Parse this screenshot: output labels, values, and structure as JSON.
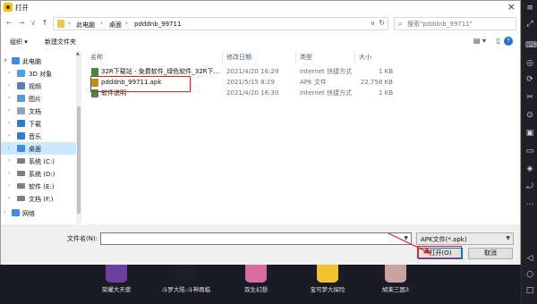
{
  "dialog": {
    "title": "打开",
    "close_glyph": "×"
  },
  "address": {
    "crumbs": [
      "此电脑",
      "桌面",
      "pdddnb_99711"
    ],
    "separator": "›",
    "dropdown_glyph": "∨",
    "refresh_glyph": "↻"
  },
  "search": {
    "placeholder": "搜索\"pdddnb_99711\""
  },
  "toolbar": {
    "organize_label": "组织 ▾",
    "new_folder_label": "新建文件夹"
  },
  "nav": {
    "items": [
      {
        "label": "此电脑",
        "icon": "computer-icon",
        "color": "#3b8ee8"
      },
      {
        "label": "3D 对象",
        "icon": "cube-icon",
        "color": "#4aa3df"
      },
      {
        "label": "视频",
        "icon": "video-icon",
        "color": "#5b7db1"
      },
      {
        "label": "图片",
        "icon": "picture-icon",
        "color": "#5b9bd5"
      },
      {
        "label": "文档",
        "icon": "document-icon",
        "color": "#8da4c0"
      },
      {
        "label": "下载",
        "icon": "download-icon",
        "color": "#2f7ccf"
      },
      {
        "label": "音乐",
        "icon": "music-icon",
        "color": "#2f7ccf"
      },
      {
        "label": "桌面",
        "icon": "desktop-icon",
        "color": "#3b8ee8"
      },
      {
        "label": "系统 (C:)",
        "icon": "drive-icon",
        "color": "#7f7f7f"
      },
      {
        "label": "系统 (D:)",
        "icon": "drive-icon",
        "color": "#7f7f7f"
      },
      {
        "label": "软件 (E:)",
        "icon": "drive-icon",
        "color": "#7f7f7f"
      },
      {
        "label": "文档 (F:)",
        "icon": "drive-icon",
        "color": "#7f7f7f"
      },
      {
        "label": "网络",
        "icon": "network-icon",
        "color": "#3b8ee8"
      }
    ]
  },
  "files": {
    "columns": [
      "名称",
      "修改日期",
      "类型",
      "大小"
    ],
    "rows": [
      {
        "name": "32R下载站 - 免费软件_绿色软件_32R下...",
        "date": "2021/4/20 16:29",
        "type": "Internet 快捷方式",
        "size": "1 KB",
        "icon": "shortcut-icon",
        "color": "#3c8f3c"
      },
      {
        "name": "pdddnb_99711.apk",
        "date": "2021/5/15 8:29",
        "type": "APK 文件",
        "size": "22,758 KB",
        "icon": "apk-icon",
        "color": "#c58a1a"
      },
      {
        "name": "软件说明",
        "date": "2021/4/20 16:30",
        "type": "Internet 快捷方式",
        "size": "1 KB",
        "icon": "shortcut-icon",
        "color": "#3c8f3c"
      }
    ]
  },
  "bottom": {
    "filename_label": "文件名(N):",
    "filename_value": "",
    "filetype_value": "APK文件(*.apk)",
    "open_label": "打开(O)",
    "cancel_label": "取消"
  },
  "games": [
    {
      "name": "荣耀大天使",
      "color": "#6b3fa0"
    },
    {
      "name": "斗罗大陆-斗神再临",
      "color": "#1c1c2a"
    },
    {
      "name": "双生幻想",
      "color": "#d96ba3"
    },
    {
      "name": "宝可梦大探险",
      "color": "#f2c230"
    },
    {
      "name": "胡莱三国3",
      "color": "#c9a1a1"
    }
  ]
}
